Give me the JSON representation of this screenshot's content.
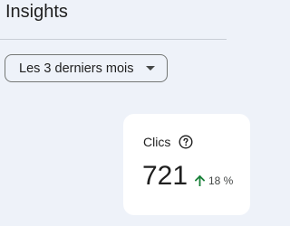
{
  "header": {
    "title": "Insights"
  },
  "filters": {
    "date_range": {
      "selected": "Les 3 derniers mois",
      "icon": "arrow-drop-down-icon"
    }
  },
  "metrics": [
    {
      "label": "Clics",
      "help_icon": "help-circle-icon",
      "value": "721",
      "trend_icon": "arrow-up-icon",
      "trend_value": "18 %",
      "trend_color": "#188038"
    }
  ]
}
